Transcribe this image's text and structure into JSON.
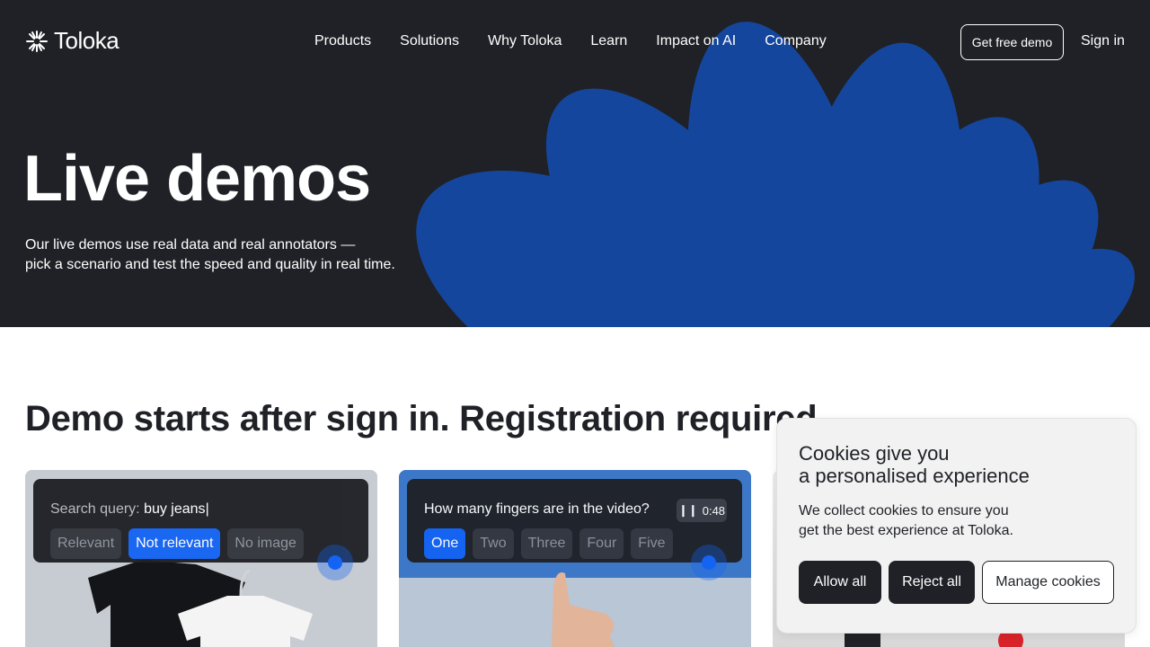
{
  "nav": {
    "logo_text": "Toloka",
    "items": [
      "Products",
      "Solutions",
      "Why Toloka",
      "Learn",
      "Impact on AI",
      "Company"
    ],
    "demo_button": "Get free demo",
    "signin": "Sign in"
  },
  "hero": {
    "title": "Live demos",
    "subtitle_line1": "Our live demos use real data and real annotators —",
    "subtitle_line2": "pick a scenario and test the speed and quality in real time."
  },
  "section": {
    "title": "Demo starts after sign in. Registration required"
  },
  "cards": [
    {
      "query_label": "Search query:",
      "query_value": "buy jeans",
      "options": [
        "Relevant",
        "Not relevant",
        "No image"
      ],
      "selected": "Not relevant"
    },
    {
      "question": "How many fingers are in the video?",
      "timer": "0:48",
      "options": [
        "One",
        "Two",
        "Three",
        "Four",
        "Five"
      ],
      "selected": "One"
    }
  ],
  "cookie": {
    "title_line1": "Cookies give you",
    "title_line2": "a personalised experience",
    "text_line1": "We collect cookies to ensure you",
    "text_line2": "get the best experience at Toloka.",
    "allow": "Allow all",
    "reject": "Reject all",
    "manage": "Manage cookies"
  },
  "colors": {
    "hero_bg": "#1f2126",
    "accent": "#1463f3",
    "petal": "#0f5ee8"
  }
}
